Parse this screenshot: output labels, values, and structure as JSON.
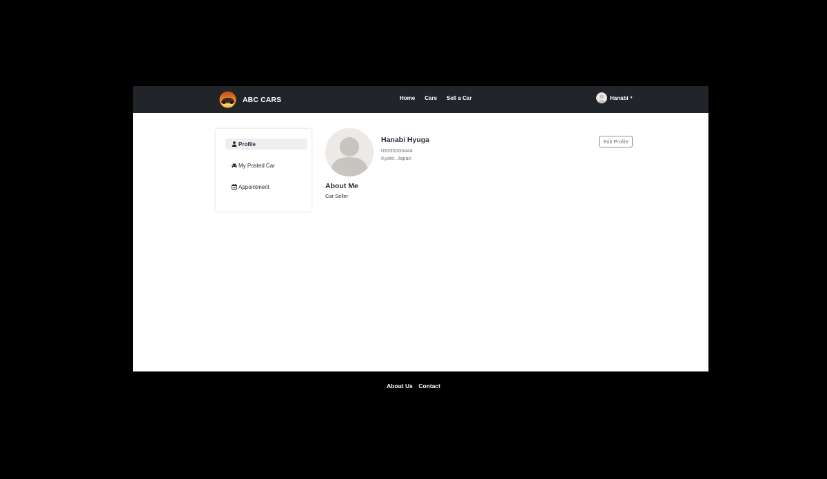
{
  "navbar": {
    "brand": "ABC CARS",
    "links": [
      "Home",
      "Cars",
      "Sell a Car"
    ],
    "user_name": "Hanabi"
  },
  "sidebar": {
    "items": [
      {
        "label": "Profile",
        "icon": "user-icon",
        "active": true
      },
      {
        "label": "My Posted Car",
        "icon": "car-icon",
        "active": false
      },
      {
        "label": "Appointment",
        "icon": "calendar-icon",
        "active": false
      }
    ]
  },
  "profile": {
    "name": "Hanabi Hyuga",
    "phone": "09335000444",
    "location": "Kyoto, Japan",
    "edit_label": "Edit Profile",
    "about_title": "About Me",
    "about_text": "Car Seller"
  },
  "footer": {
    "links": [
      "About Us",
      "Contact"
    ]
  },
  "colors": {
    "navbar_bg": "#212529",
    "page_bg": "#000000",
    "content_bg": "#ffffff",
    "active_item_bg": "#eceef0"
  }
}
